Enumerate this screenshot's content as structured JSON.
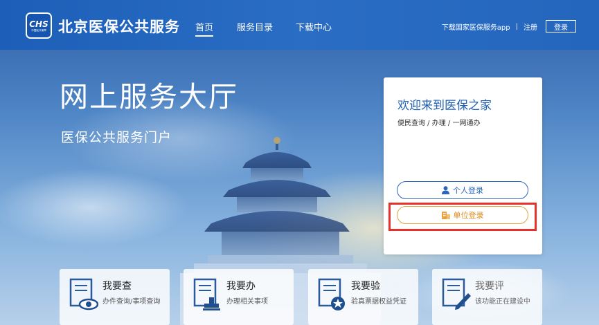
{
  "header": {
    "logo_text": "CHS",
    "logo_subtext": "中国医疗保障",
    "site_title": "北京医保公共服务",
    "nav": [
      {
        "label": "首页",
        "active": true
      },
      {
        "label": "服务目录",
        "active": false
      },
      {
        "label": "下载中心",
        "active": false
      }
    ],
    "download_app": "下载国家医保服务app",
    "separator": "|",
    "register": "注册",
    "login": "登录"
  },
  "hero": {
    "title": "网上服务大厅",
    "subtitle": "医保公共服务门户"
  },
  "login_card": {
    "title": "欢迎来到医保之家",
    "subtitle": "便民查询 / 办理 / 一网通办",
    "personal_login": "个人登录",
    "unit_login": "单位登录"
  },
  "tiles": [
    {
      "name": "我要查",
      "desc": "办件查询/事项查询",
      "icon": "eye-document-icon"
    },
    {
      "name": "我要办",
      "desc": "办理相关事项",
      "icon": "stamp-document-icon"
    },
    {
      "name": "我要验",
      "desc": "验真票据权益凭证",
      "icon": "star-badge-document-icon"
    },
    {
      "name": "我要评",
      "desc": "该功能正在建设中",
      "icon": "pen-document-icon"
    }
  ],
  "colors": {
    "header_blue": "#2466bd",
    "personal_btn": "#2a66bb",
    "unit_btn": "#e8a040",
    "highlight_red": "#e8302a"
  }
}
